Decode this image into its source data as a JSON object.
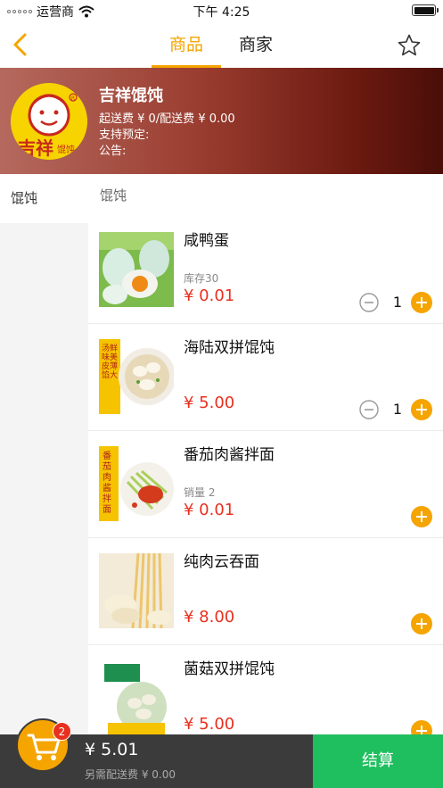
{
  "status_bar": {
    "carrier": "运营商",
    "time": "下午 4:25"
  },
  "nav": {
    "tabs": [
      "商品",
      "商家"
    ],
    "active_tab": 0
  },
  "store": {
    "name": "吉祥馄饨",
    "logo_text": "吉祥",
    "logo_sub": "馄饨",
    "delivery_fee": "起送费 ¥ 0/配送费 ¥ 0.00",
    "reservation": "支持预定:",
    "notice": "公告:"
  },
  "categories": [
    {
      "label": "馄饨",
      "selected": true
    }
  ],
  "list_header": "馄饨",
  "products": [
    {
      "name": "咸鸭蛋",
      "meta": "库存30",
      "price": "¥ 0.01",
      "qty": "1",
      "in_cart": true,
      "image": "salted-duck-egg"
    },
    {
      "name": "海陆双拼馄饨",
      "meta": "",
      "price": "¥ 5.00",
      "qty": "1",
      "in_cart": true,
      "image": "wonton-bowl",
      "image_text": "汤鲜味美 皮薄馅大"
    },
    {
      "name": "番茄肉酱拌面",
      "meta": "销量 2",
      "price": "¥ 0.01",
      "qty": "",
      "in_cart": false,
      "image": "tomato-noodles",
      "image_text": "番茄肉酱拌面"
    },
    {
      "name": "纯肉云吞面",
      "meta": "",
      "price": "¥ 8.00",
      "qty": "",
      "in_cart": false,
      "image": "wonton-noodles"
    },
    {
      "name": "菌菇双拼馄饨",
      "meta": "",
      "price": "¥ 5.00",
      "qty": "",
      "in_cart": false,
      "image": "mushroom-wonton"
    }
  ],
  "cart": {
    "badge": "2",
    "total": "¥ 5.01",
    "note": "另需配送费 ¥ 0.00",
    "checkout_label": "结算"
  },
  "colors": {
    "accent": "#f5a400",
    "price": "#e8301f",
    "checkout": "#1fbe5e",
    "cart_bar": "#3b3b3b"
  }
}
